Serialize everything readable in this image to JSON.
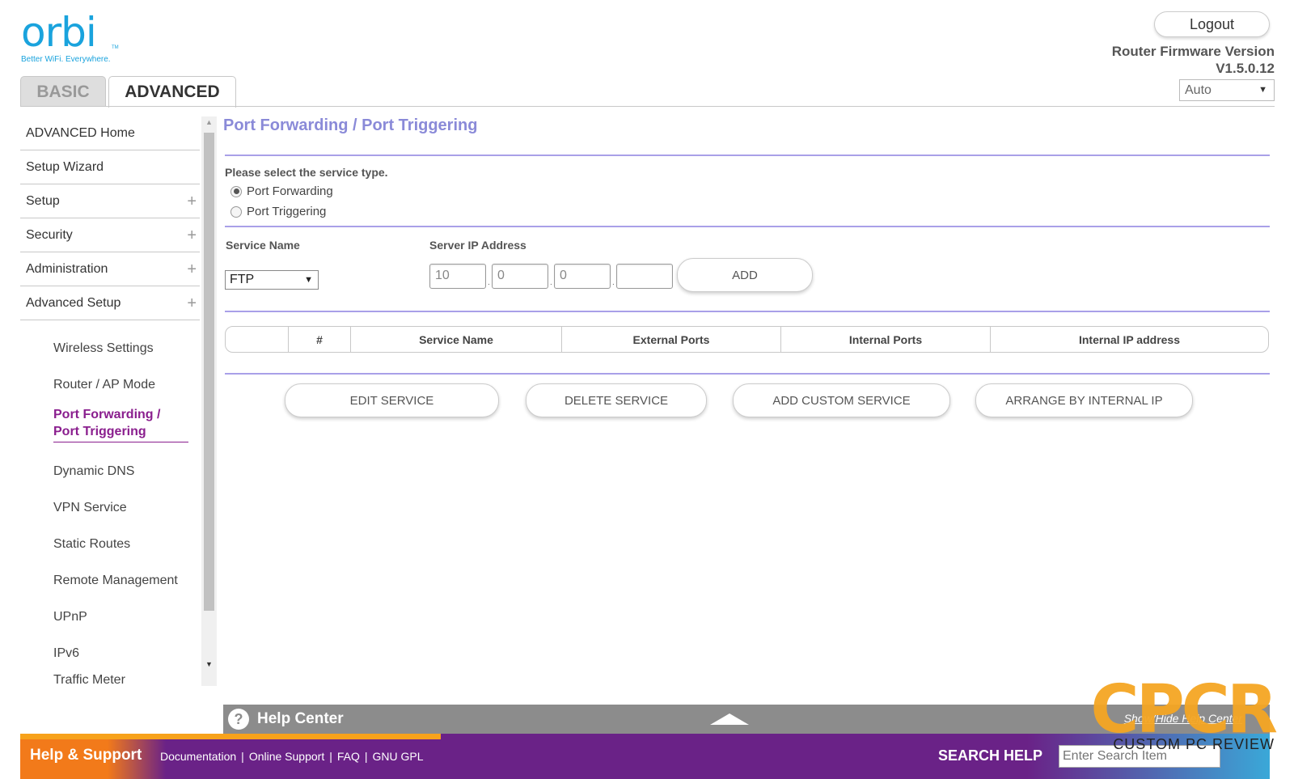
{
  "brand": {
    "logo": "orbi",
    "tm": "TM",
    "tagline": "Better WiFi. Everywhere."
  },
  "tabs": {
    "basic": "BASIC",
    "advanced": "ADVANCED"
  },
  "header": {
    "logout": "Logout",
    "fw_label": "Router Firmware Version",
    "fw_version": "V1.5.0.12",
    "language": "Auto"
  },
  "sidebar": {
    "items": [
      {
        "label": "ADVANCED Home",
        "expandable": false
      },
      {
        "label": "Setup Wizard",
        "expandable": false
      },
      {
        "label": "Setup",
        "expandable": true
      },
      {
        "label": "Security",
        "expandable": true
      },
      {
        "label": "Administration",
        "expandable": true
      },
      {
        "label": "Advanced Setup",
        "expandable": true
      }
    ],
    "sub_items": [
      "Wireless Settings",
      "Router / AP Mode",
      "Port Forwarding /",
      "Port Triggering",
      "Dynamic DNS",
      "VPN Service",
      "Static Routes",
      "Remote Management",
      "UPnP",
      "IPv6",
      "Traffic Meter"
    ]
  },
  "main": {
    "title": "Port Forwarding / Port Triggering",
    "service_type_label": "Please select the service type.",
    "radio_options": [
      "Port Forwarding",
      "Port Triggering"
    ],
    "selected_radio": "Port Forwarding",
    "service_name_label": "Service Name",
    "service_name_value": "FTP",
    "server_ip_label": "Server IP Address",
    "ip": [
      "10",
      "0",
      "0",
      ""
    ],
    "add_button": "ADD",
    "table_headers": [
      "",
      "#",
      "Service Name",
      "External Ports",
      "Internal Ports",
      "Internal IP address"
    ],
    "actions": [
      "EDIT SERVICE",
      "DELETE SERVICE",
      "ADD CUSTOM SERVICE",
      "ARRANGE BY INTERNAL IP"
    ]
  },
  "help_center": {
    "title": "Help Center",
    "icon": "?",
    "toggle": "Show/Hide Help Center"
  },
  "footer": {
    "title": "Help & Support",
    "links": [
      "Documentation",
      "Online Support",
      "FAQ",
      "GNU GPL"
    ],
    "search_title": "SEARCH HELP",
    "search_placeholder": "Enter Search Item"
  },
  "watermark": {
    "big": "CPCR",
    "small": "CUSTOM PC REVIEW"
  },
  "colors": {
    "accent": "#8a8ad8",
    "active_nav": "#8a1e8e",
    "footer": "#6a2287",
    "brand": "#1aa3dd"
  }
}
